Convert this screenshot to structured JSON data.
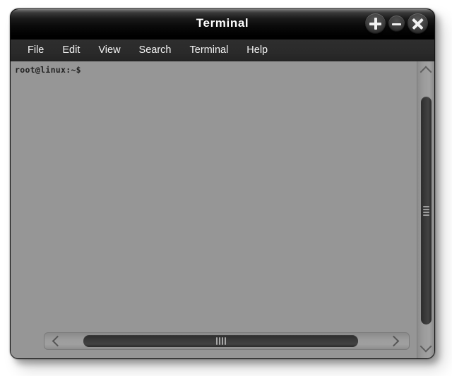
{
  "window": {
    "title": "Terminal",
    "title_buttons": [
      {
        "name": "maximize-button",
        "glyph": "plus",
        "label": "+"
      },
      {
        "name": "minimize-button",
        "glyph": "minus",
        "label": "−"
      },
      {
        "name": "close-button",
        "glyph": "close",
        "label": "×"
      }
    ]
  },
  "menu": {
    "items": [
      {
        "label": "File"
      },
      {
        "label": "Edit"
      },
      {
        "label": "View"
      },
      {
        "label": "Search"
      },
      {
        "label": "Terminal"
      },
      {
        "label": "Help"
      }
    ]
  },
  "terminal": {
    "prompt": "root@linux:~$",
    "lines": [
      "root@linux:~$"
    ],
    "background_color": "#969696",
    "text_color": "#242424"
  },
  "scrollbars": {
    "vertical": {
      "up_arrow_icon": "chevron-up-icon",
      "down_arrow_icon": "chevron-down-icon",
      "grip_lines": 4
    },
    "horizontal": {
      "left_arrow_icon": "chevron-left-icon",
      "right_arrow_icon": "chevron-right-icon",
      "grip_lines": 4
    }
  },
  "colors": {
    "titlebar_dark": "#000000",
    "menubar": "#2a2a2a",
    "body_gray": "#989898",
    "terminal_gray": "#969696",
    "thumb_dark": "#3a3a3a",
    "desktop": "#ffffff"
  }
}
